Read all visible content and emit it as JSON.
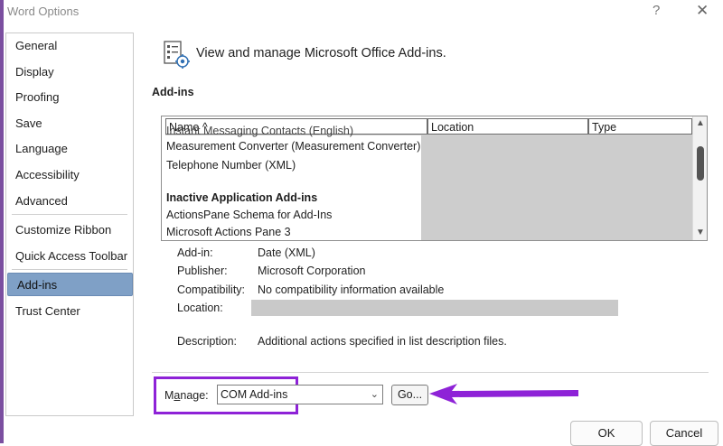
{
  "window": {
    "title": "Word Options",
    "help": "?",
    "close": "✕"
  },
  "sidebar": {
    "items": [
      {
        "label": "General"
      },
      {
        "label": "Display"
      },
      {
        "label": "Proofing"
      },
      {
        "label": "Save"
      },
      {
        "label": "Language"
      },
      {
        "label": "Accessibility"
      },
      {
        "label": "Advanced"
      },
      {
        "label": "Customize Ribbon"
      },
      {
        "label": "Quick Access Toolbar"
      },
      {
        "label": "Add-ins"
      },
      {
        "label": "Trust Center"
      }
    ],
    "selected": "Add-ins"
  },
  "main": {
    "header": "View and manage Microsoft Office Add-ins.",
    "section": "Add-ins",
    "table": {
      "columns": [
        "Name ^",
        "Location",
        "Type"
      ],
      "rows": [
        {
          "name": "Instant Messaging Contacts (English)",
          "cut": true
        },
        {
          "name": "Measurement Converter (Measurement Converter)"
        },
        {
          "name": "Telephone Number (XML)"
        },
        {
          "name": ""
        },
        {
          "name": "Inactive Application Add-ins",
          "bold": true
        },
        {
          "name": "ActionsPane Schema for Add-Ins"
        },
        {
          "name": "Microsoft Actions Pane 3"
        }
      ]
    },
    "details": {
      "addin_label": "Add-in:",
      "addin_value": "Date (XML)",
      "publisher_label": "Publisher:",
      "publisher_value": "Microsoft Corporation",
      "compat_label": "Compatibility:",
      "compat_value": "No compatibility information available",
      "location_label": "Location:",
      "desc_label": "Description:",
      "desc_value": "Additional actions specified in list description files."
    },
    "manage": {
      "label_pre": "M",
      "label_u": "a",
      "label_post": "nage:",
      "value": "COM Add-ins",
      "go": "Go..."
    }
  },
  "footer": {
    "ok": "OK",
    "cancel": "Cancel"
  },
  "colors": {
    "highlight": "#8e22d7",
    "selected": "#7fa0c6",
    "accent": "#7b4fa0"
  }
}
